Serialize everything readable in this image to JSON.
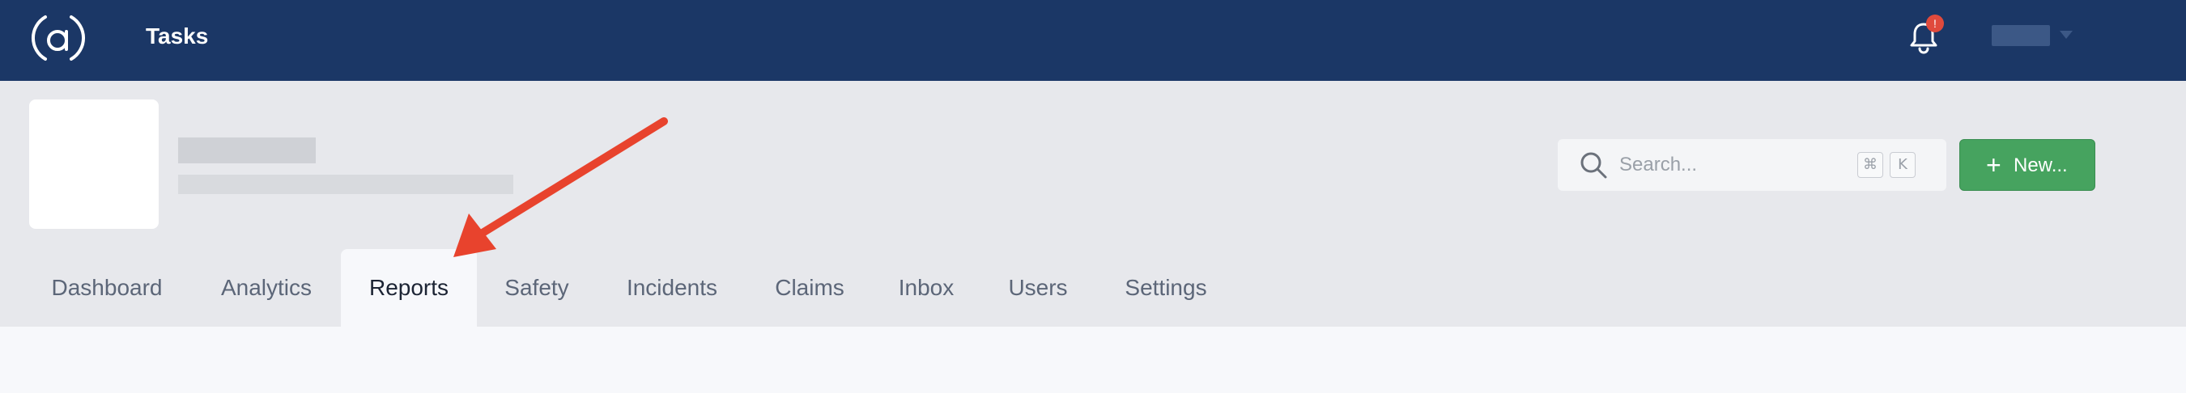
{
  "topbar": {
    "app_title": "Tasks",
    "notification_count": "!",
    "colors": {
      "background": "#1b3766",
      "badge": "#e04a3c"
    },
    "icons": [
      "logo-icon",
      "bell-icon",
      "caret-down-icon"
    ]
  },
  "header": {
    "search": {
      "placeholder": "Search...",
      "shortcut_modifier": "⌘",
      "shortcut_key": "K"
    },
    "new_button": {
      "plus": "+",
      "label": "New..."
    }
  },
  "tabs": [
    {
      "label": "Dashboard",
      "active": false
    },
    {
      "label": "Analytics",
      "active": false
    },
    {
      "label": "Reports",
      "active": true
    },
    {
      "label": "Safety",
      "active": false
    },
    {
      "label": "Incidents",
      "active": false
    },
    {
      "label": "Claims",
      "active": false
    },
    {
      "label": "Inbox",
      "active": false
    },
    {
      "label": "Users",
      "active": false
    },
    {
      "label": "Settings",
      "active": false
    }
  ],
  "annotation": {
    "color": "#e8432d",
    "target": "Reports"
  }
}
